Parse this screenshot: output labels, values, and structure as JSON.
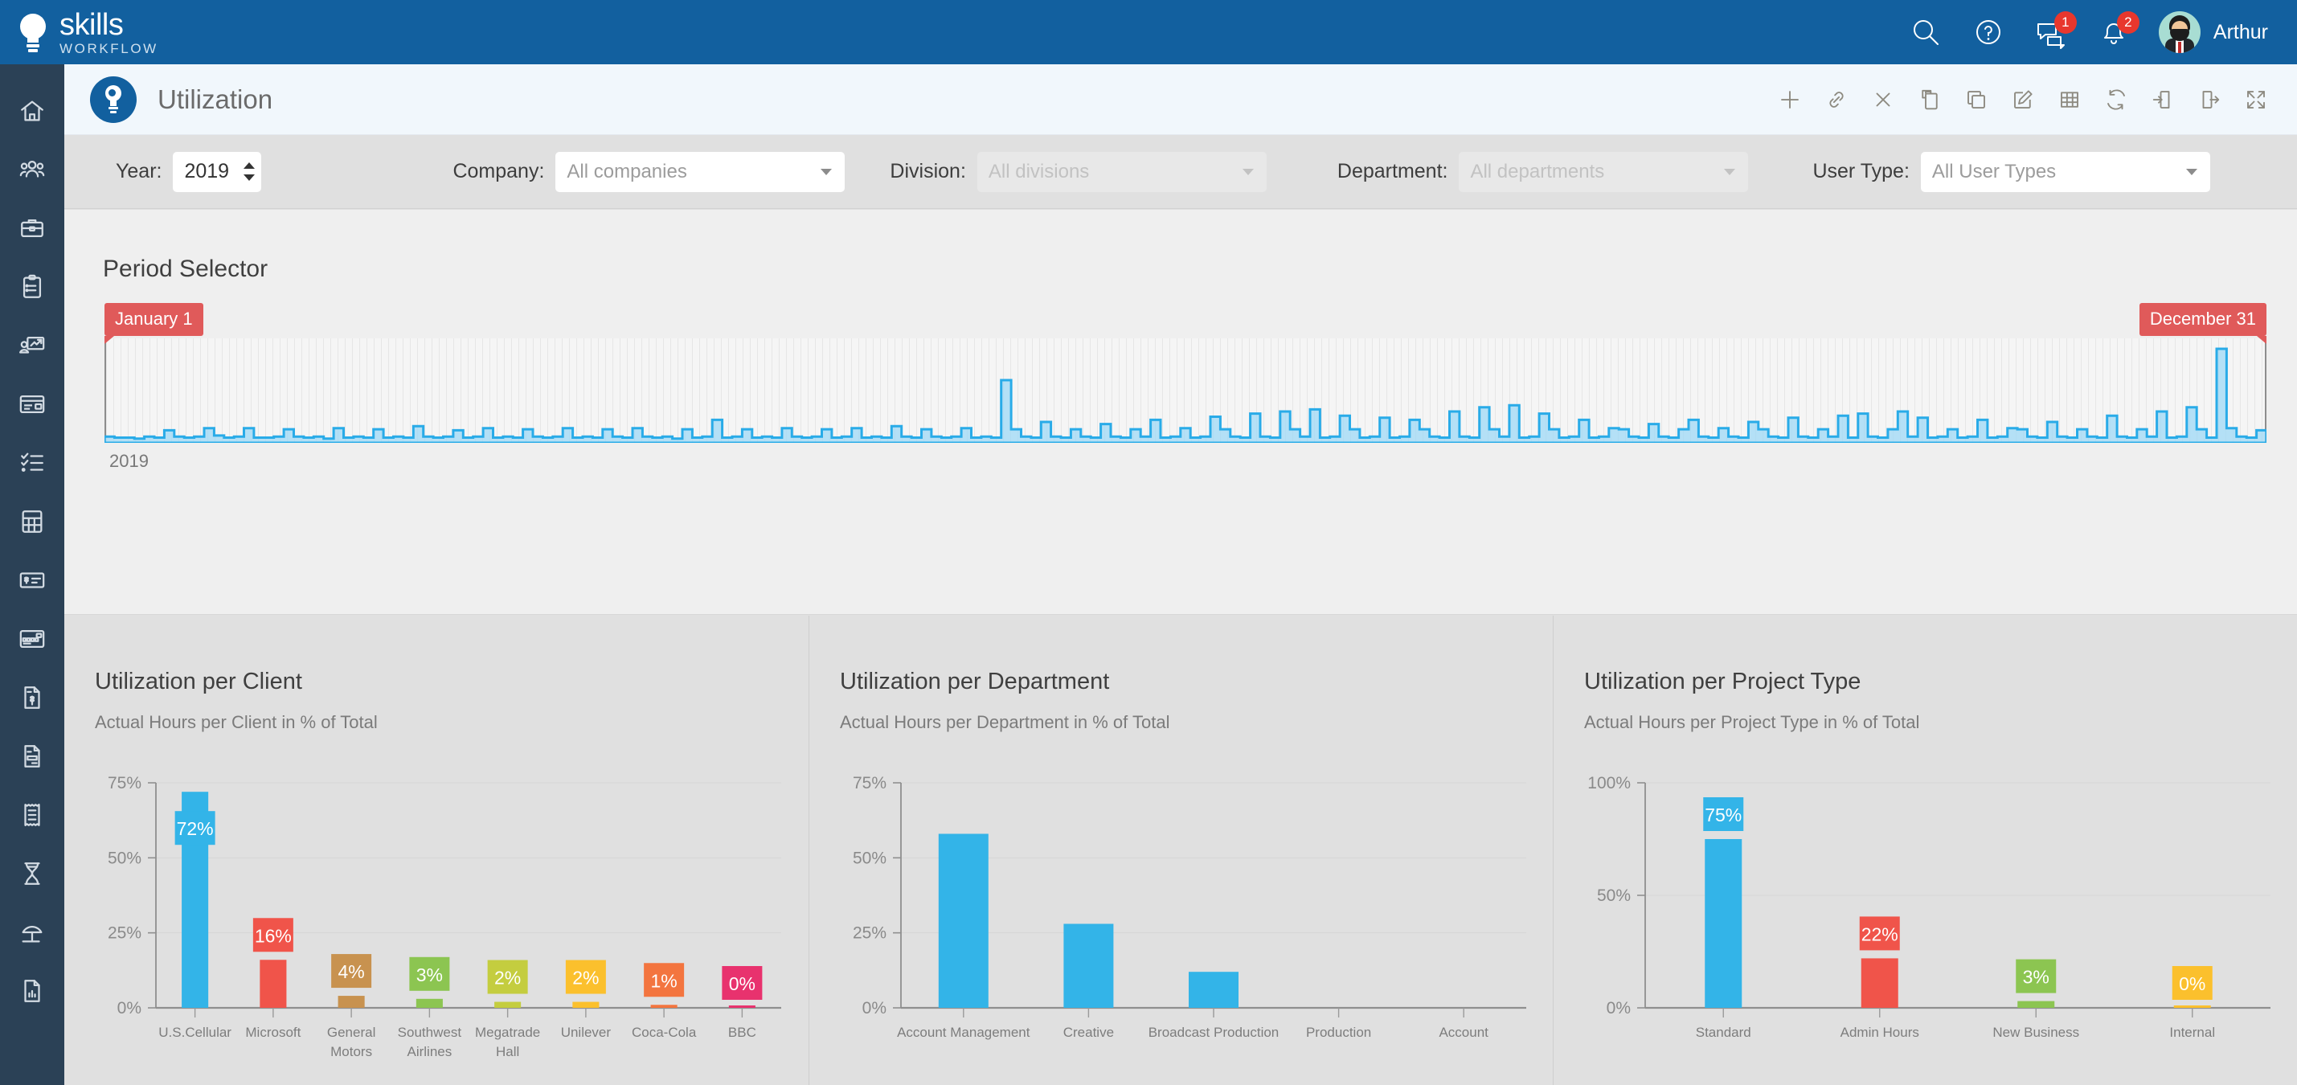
{
  "brand": {
    "name": "skills",
    "subtitle": "WORKFLOW",
    "primary_color": "#12609f",
    "sidebar_color": "#2b4156"
  },
  "topbar": {
    "search_icon": "search-icon",
    "help_icon": "help-circle-icon",
    "messages_icon": "chat-icon",
    "messages_badge": "1",
    "notifications_icon": "bell-icon",
    "notifications_badge": "2",
    "user_name": "Arthur"
  },
  "sidebar": {
    "items": [
      {
        "icon": "home-icon",
        "label": "Home"
      },
      {
        "icon": "people-icon",
        "label": "People"
      },
      {
        "icon": "briefcase-icon",
        "label": "Jobs"
      },
      {
        "icon": "clipboard-list-icon",
        "label": "Tasks"
      },
      {
        "icon": "presentation-chart-icon",
        "label": "Pitches"
      },
      {
        "icon": "id-card-icon",
        "label": "Cards"
      },
      {
        "icon": "checklist-icon",
        "label": "Checklists"
      },
      {
        "icon": "calculator-icon",
        "label": "Estimates"
      },
      {
        "icon": "cheque-icon",
        "label": "Payments"
      },
      {
        "icon": "credit-card-icon",
        "label": "Billing"
      },
      {
        "icon": "invoice-dollar-icon",
        "label": "Invoices"
      },
      {
        "icon": "document-icon",
        "label": "Documents"
      },
      {
        "icon": "receipt-icon",
        "label": "Receipts"
      },
      {
        "icon": "hourglass-icon",
        "label": "Timesheets"
      },
      {
        "icon": "umbrella-icon",
        "label": "Absences"
      },
      {
        "icon": "report-chart-icon",
        "label": "Reports"
      }
    ]
  },
  "page": {
    "icon": "lightbulb-icon",
    "title": "Utilization",
    "actions": [
      {
        "icon": "plus-icon",
        "label": "New"
      },
      {
        "icon": "link-icon",
        "label": "Link"
      },
      {
        "icon": "close-icon",
        "label": "Close"
      },
      {
        "icon": "paste-icon",
        "label": "Paste"
      },
      {
        "icon": "copy-icon",
        "label": "Copy"
      },
      {
        "icon": "edit-icon",
        "label": "Edit"
      },
      {
        "icon": "table-icon",
        "label": "Table"
      },
      {
        "icon": "refresh-icon",
        "label": "Refresh"
      },
      {
        "icon": "import-icon",
        "label": "Import"
      },
      {
        "icon": "export-icon",
        "label": "Export"
      },
      {
        "icon": "expand-icon",
        "label": "Full screen"
      }
    ]
  },
  "filters": {
    "year": {
      "label": "Year:",
      "value": "2019"
    },
    "company": {
      "label": "Company:",
      "value": "All companies",
      "disabled": false
    },
    "division": {
      "label": "Division:",
      "value": "All divisions",
      "disabled": true
    },
    "department": {
      "label": "Department:",
      "value": "All departments",
      "disabled": true
    },
    "user_type": {
      "label": "User Type:",
      "value": "All User Types",
      "disabled": false
    }
  },
  "period_selector": {
    "title": "Period Selector",
    "start_handle": "January 1",
    "end_handle": "December 31",
    "axis_year": "2019"
  },
  "chart_data": [
    {
      "type": "bar",
      "title": "Utilization per Client",
      "subtitle": "Actual Hours per Client in % of Total",
      "xlabel": "",
      "ylabel": "",
      "ylim": [
        0,
        75
      ],
      "yticks": [
        "0%",
        "25%",
        "50%",
        "75%"
      ],
      "ytick_values": [
        0,
        25,
        50,
        75
      ],
      "grid": true,
      "categories": [
        "U.S.Cellular",
        "Microsoft",
        "General Motors",
        "Southwest Airlines",
        "Megatrade Hall",
        "Unilever",
        "Coca-Cola",
        "BBC"
      ],
      "values": [
        72,
        16,
        4,
        3,
        2,
        2,
        1,
        0
      ],
      "labels": [
        "72%",
        "16%",
        "4%",
        "3%",
        "2%",
        "2%",
        "1%",
        "0%"
      ],
      "colors": [
        "#33b4e8",
        "#f0544a",
        "#c8924f",
        "#8cc551",
        "#c4cd3f",
        "#fbc02d",
        "#f3753f",
        "#e8326e"
      ]
    },
    {
      "type": "bar",
      "title": "Utilization per Department",
      "subtitle": "Actual Hours per Department in % of Total",
      "xlabel": "",
      "ylabel": "",
      "ylim": [
        0,
        75
      ],
      "yticks": [
        "0%",
        "25%",
        "50%",
        "75%"
      ],
      "ytick_values": [
        0,
        25,
        50,
        75
      ],
      "grid": true,
      "categories": [
        "Account Management",
        "Creative",
        "Broadcast Production",
        "Production",
        "Account"
      ],
      "values": [
        58,
        28,
        12,
        0,
        0
      ],
      "labels": [
        "",
        "",
        "",
        "",
        ""
      ],
      "colors": [
        "#33b4e8",
        "#33b4e8",
        "#33b4e8",
        "#33b4e8",
        "#33b4e8"
      ]
    },
    {
      "type": "bar",
      "title": "Utilization per Project Type",
      "subtitle": "Actual Hours per Project Type in % of Total",
      "xlabel": "",
      "ylabel": "",
      "ylim": [
        0,
        100
      ],
      "yticks": [
        "0%",
        "50%",
        "100%"
      ],
      "ytick_values": [
        0,
        50,
        100
      ],
      "grid": true,
      "categories": [
        "Standard",
        "Admin Hours",
        "New Business",
        "Internal"
      ],
      "values": [
        75,
        22,
        3,
        0
      ],
      "labels": [
        "75%",
        "22%",
        "3%",
        "0%"
      ],
      "colors": [
        "#33b4e8",
        "#f0544a",
        "#8cc551",
        "#fbc02d"
      ]
    }
  ]
}
